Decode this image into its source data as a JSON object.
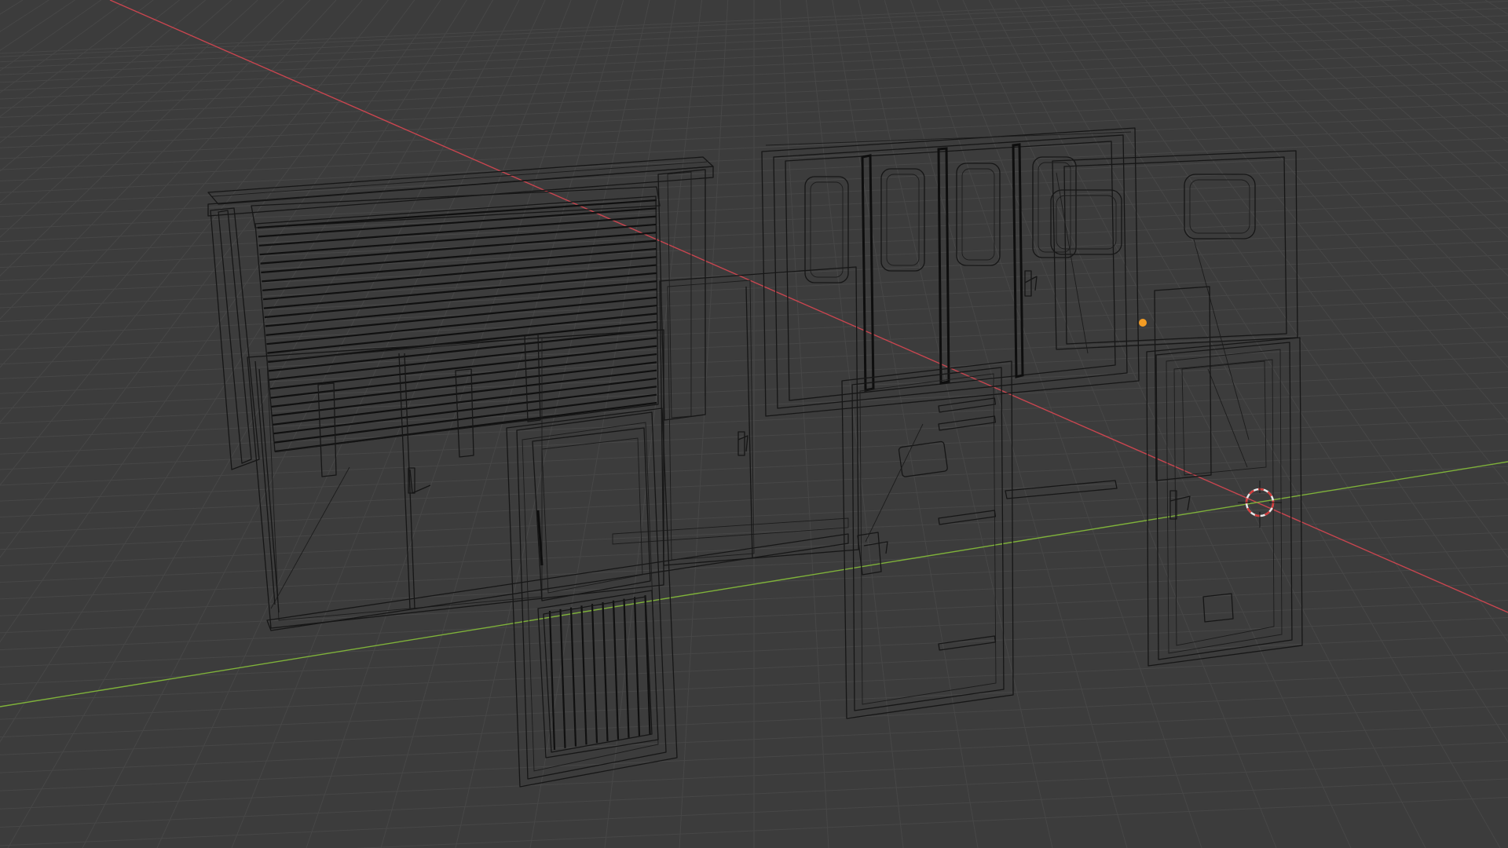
{
  "viewport": {
    "mode": "Wireframe",
    "background_color": "#3c3c3c",
    "grid_color": "#474747",
    "wire_color": "#161616",
    "x_axis_color": "#c8454f",
    "y_axis_color": "#7fb23a",
    "origin_color": "#f39c24",
    "cursor_color": "#e8e8e8",
    "cursor_accent_color": "#d33b3b"
  },
  "scene": {
    "objects": [
      {
        "name": "rolling-shutter-wall"
      },
      {
        "name": "double-door-left"
      },
      {
        "name": "gate-door-barred"
      },
      {
        "name": "wall-panel-with-windows"
      },
      {
        "name": "single-door-middle"
      },
      {
        "name": "single-door-right"
      }
    ]
  },
  "origin_icon": "object-origin-dot",
  "cursor_icon": "3d-cursor-icon"
}
